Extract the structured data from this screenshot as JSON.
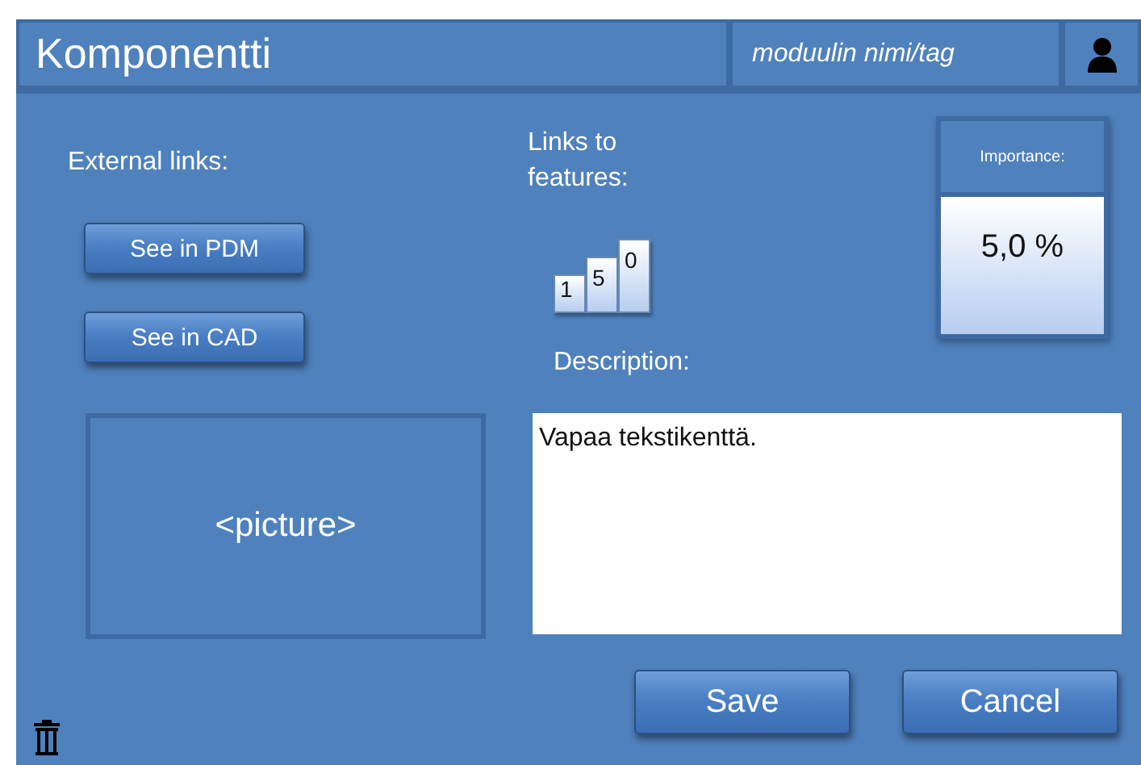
{
  "header": {
    "title": "Komponentti",
    "tag": "moduulin nimi/tag"
  },
  "external_links": {
    "label": "External links:",
    "buttons": [
      "See in PDM",
      "See in CAD"
    ]
  },
  "picture_frame": {
    "caption": "<picture>"
  },
  "features": {
    "label": "Links to features:",
    "digits": [
      "1",
      "5",
      "0"
    ]
  },
  "importance": {
    "label": "Importance:",
    "value": "5,0 %"
  },
  "description": {
    "label": "Description:",
    "value": "Vapaa tekstikenttä."
  },
  "buttons": [
    "Save",
    "Cancel"
  ]
}
